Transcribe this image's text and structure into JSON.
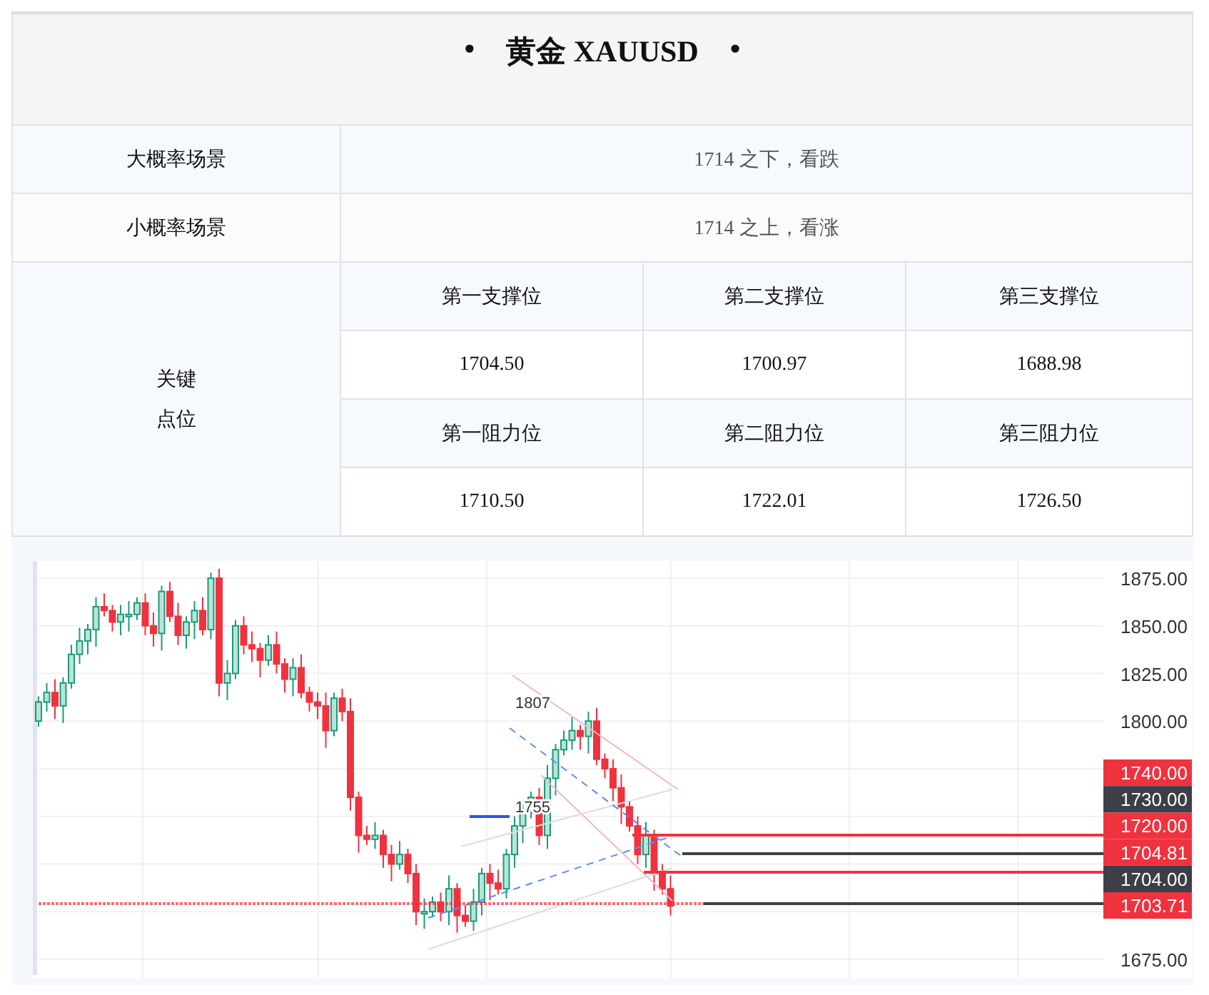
{
  "title": {
    "left_mark": "•",
    "text": "黄金 XAUUSD",
    "right_mark": "•"
  },
  "scenarios": [
    {
      "label": "大概率场景",
      "value": "1714 之下，看跌"
    },
    {
      "label": "小概率场景",
      "value": "1714 之上，看涨"
    }
  ],
  "key_levels": {
    "label_lines": [
      "关键",
      "点位"
    ],
    "groups": [
      {
        "headers": [
          "第一支撑位",
          "第二支撑位",
          "第三支撑位"
        ],
        "values": [
          "1704.50",
          "1700.97",
          "1688.98"
        ]
      },
      {
        "headers": [
          "第一阻力位",
          "第二阻力位",
          "第三阻力位"
        ],
        "values": [
          "1710.50",
          "1722.01",
          "1726.50"
        ]
      }
    ]
  },
  "chart": {
    "axis_labels": [
      "1875.00",
      "1850.00",
      "1825.00",
      "1800.00",
      "1675.00"
    ],
    "price_tags": [
      {
        "text": "1740.00",
        "color": "#f0323f"
      },
      {
        "text": "1730.00",
        "color": "#3d3f48"
      },
      {
        "text": "1720.00",
        "color": "#f0323f"
      },
      {
        "text": "1704.81",
        "color": "#f0323f"
      },
      {
        "text": "1704.00",
        "color": "#3d3f48"
      },
      {
        "text": "1703.71",
        "color": "#f0323f"
      }
    ],
    "annotations": [
      "1807",
      "1755"
    ]
  }
}
